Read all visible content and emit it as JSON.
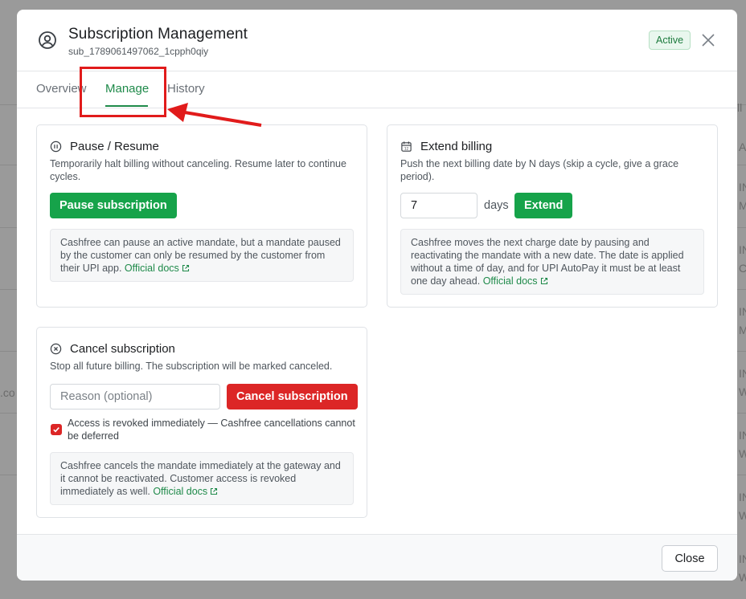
{
  "background": {
    "edge_chars": [
      ".co",
      "ll",
      "A",
      "IN",
      "M",
      "IN",
      "C",
      "IN",
      "M",
      "IN",
      "W",
      "IN",
      "W",
      "IN",
      "W",
      "IN",
      "W"
    ]
  },
  "modal": {
    "title": "Subscription Management",
    "subscription_id": "sub_1789061497062_1cpph0qiy",
    "status_badge": "Active",
    "tabs": [
      {
        "label": "Overview",
        "active": false
      },
      {
        "label": "Manage",
        "active": true
      },
      {
        "label": "History",
        "active": false
      }
    ],
    "accent_color": "#1f8a4a"
  },
  "pause": {
    "title": "Pause / Resume",
    "description": "Temporarily halt billing without canceling. Resume later to continue cycles.",
    "button_label": "Pause subscription",
    "note_text": "Cashfree can pause an active mandate, but a mandate paused by the customer can only be resumed by the customer from their UPI app.",
    "docs_link": "Official docs"
  },
  "extend": {
    "title": "Extend billing",
    "description": "Push the next billing date by N days (skip a cycle, give a grace period).",
    "days_value": "7",
    "days_label": "days",
    "button_label": "Extend",
    "note_text": "Cashfree moves the next charge date by pausing and reactivating the mandate with a new date. The date is applied without a time of day, and for UPI AutoPay it must be at least one day ahead.",
    "docs_link": "Official docs"
  },
  "cancel": {
    "title": "Cancel subscription",
    "description": "Stop all future billing. The subscription will be marked canceled.",
    "reason_placeholder": "Reason (optional)",
    "button_label": "Cancel subscription",
    "checkbox_checked": true,
    "checkbox_label": "Access is revoked immediately — Cashfree cancellations cannot be deferred",
    "note_text": "Cashfree cancels the mandate immediately at the gateway and it cannot be reactivated. Customer access is revoked immediately as well.",
    "docs_link": "Official docs"
  },
  "footer": {
    "close_label": "Close"
  }
}
